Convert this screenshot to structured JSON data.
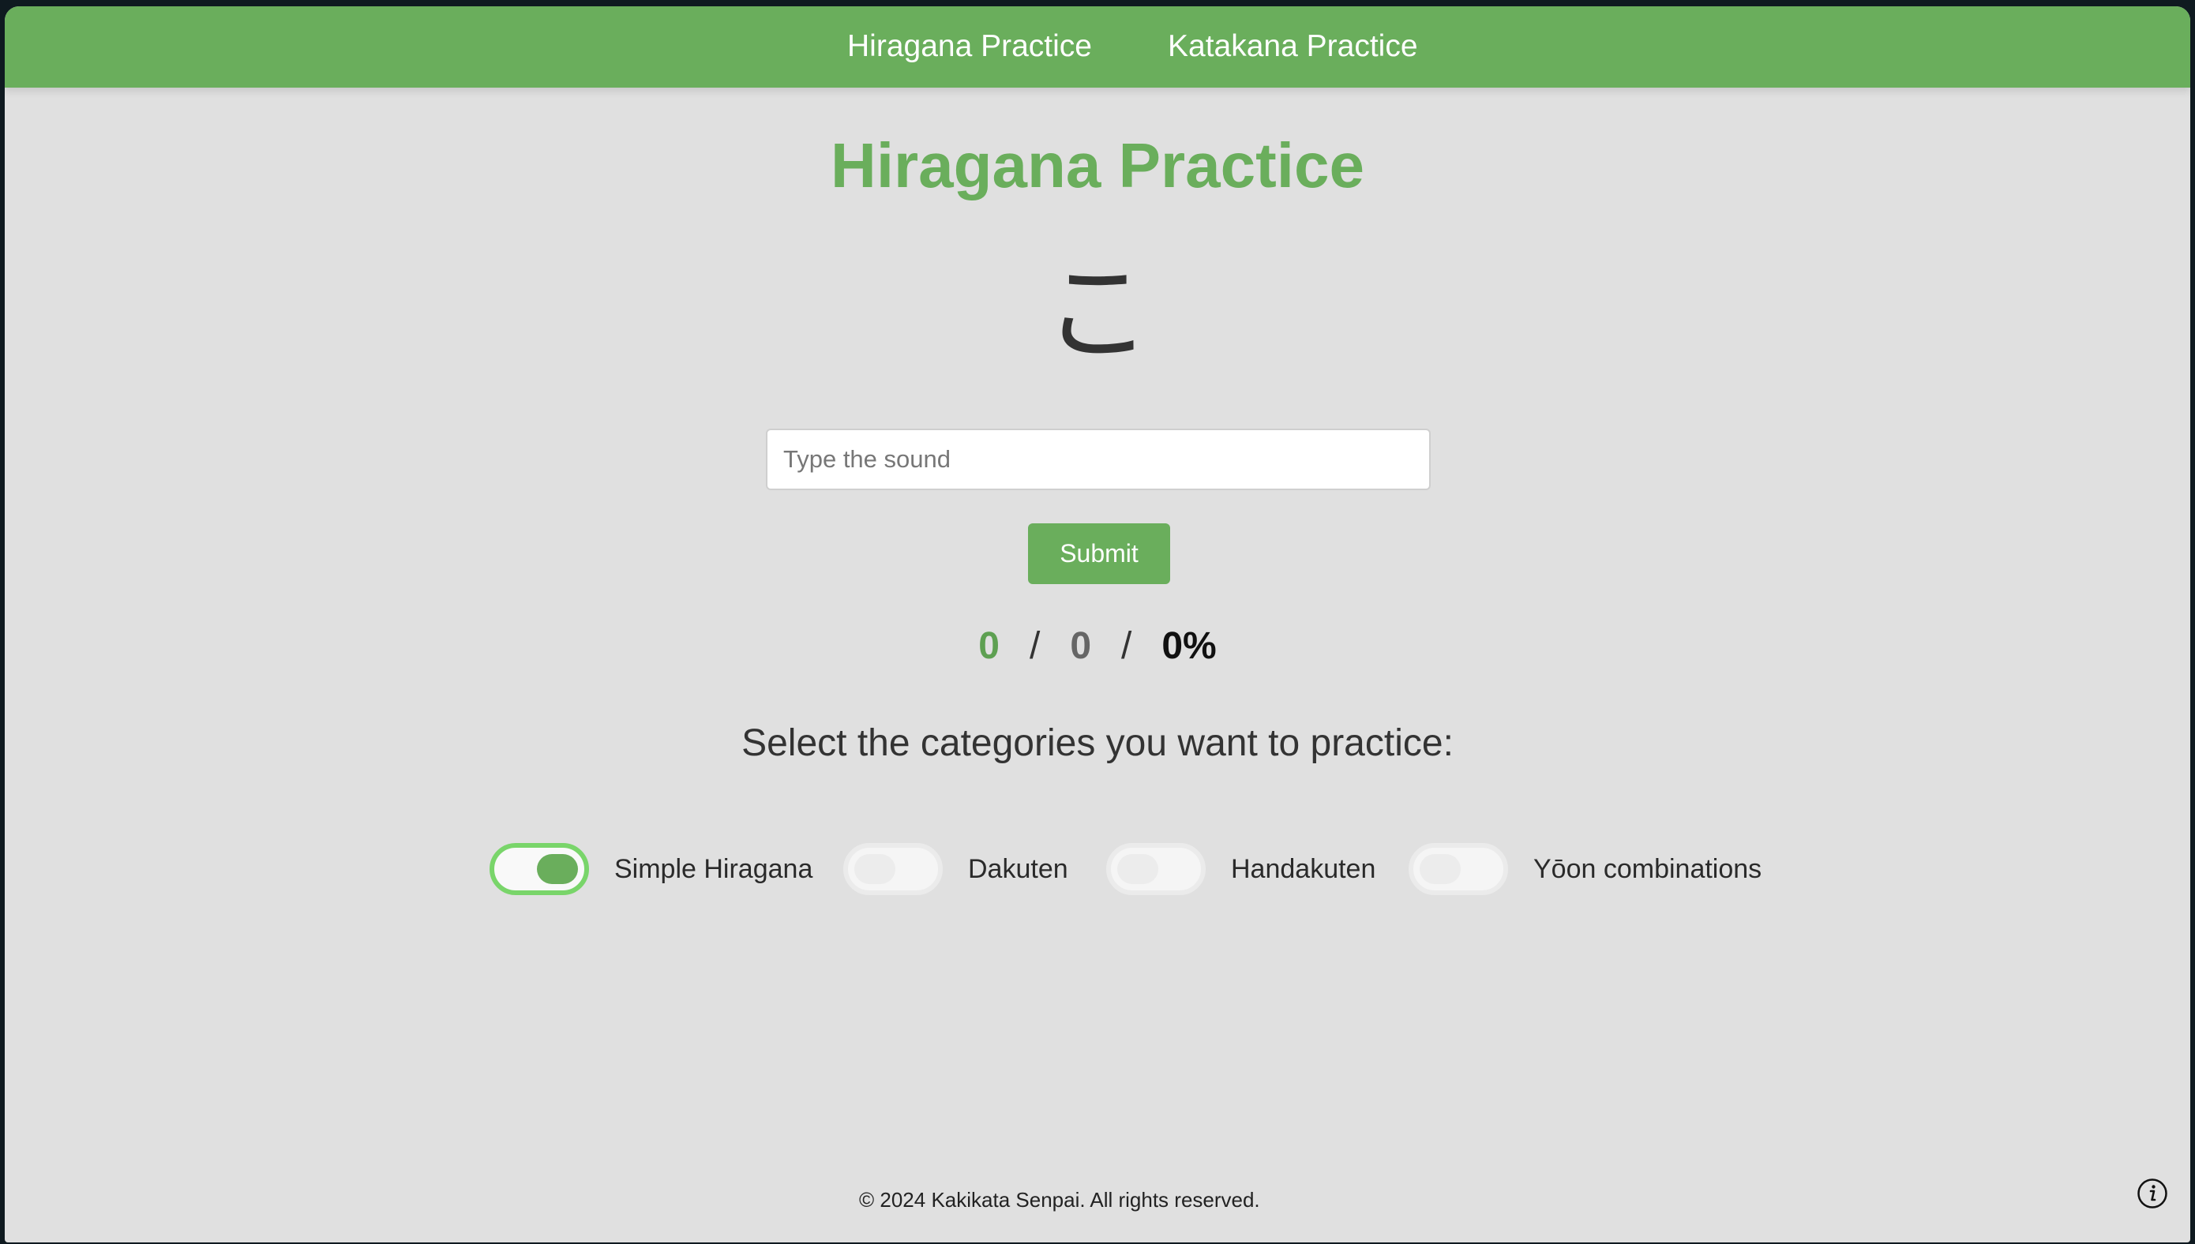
{
  "nav": {
    "links": [
      {
        "label": "Hiragana Practice"
      },
      {
        "label": "Katakana Practice"
      }
    ]
  },
  "main": {
    "title": "Hiragana Practice",
    "current_kana": "こ",
    "input_placeholder": "Type the sound",
    "input_value": "",
    "submit_label": "Submit"
  },
  "score": {
    "correct": "0",
    "separator": "/",
    "total": "0",
    "percent": "0%"
  },
  "categories": {
    "prompt": "Select the categories you want to practice:",
    "items": [
      {
        "label": "Simple Hiragana",
        "enabled": true
      },
      {
        "label": "Dakuten",
        "enabled": false
      },
      {
        "label": "Handakuten",
        "enabled": false
      },
      {
        "label": "Yōon combinations",
        "enabled": false
      }
    ]
  },
  "footer": {
    "copyright": "© 2024 Kakikata Senpai. All rights reserved."
  },
  "icons": {
    "info": "info-icon"
  },
  "colors": {
    "accent": "#6aae5c",
    "toggle_on_border": "#79d56a",
    "background": "#e0e0e0"
  }
}
